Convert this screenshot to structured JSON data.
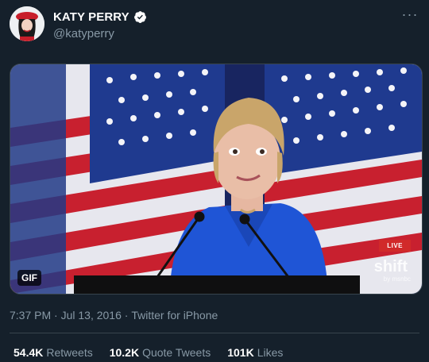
{
  "tweet": {
    "display_name": "KATY PERRY",
    "handle": "@katyperry",
    "more_label": "···"
  },
  "media": {
    "gif_label": "GIF",
    "live_label": "LIVE",
    "brand_label": "shift",
    "brand_sub_label": "by msnbc"
  },
  "meta": {
    "time": "7:37 PM",
    "sep1": " · ",
    "date": "Jul 13, 2016",
    "sep2": " · ",
    "source": "Twitter for iPhone"
  },
  "stats": {
    "retweets_count": "54.4K",
    "retweets_label": "Retweets",
    "quotes_count": "10.2K",
    "quotes_label": "Quote Tweets",
    "likes_count": "101K",
    "likes_label": "Likes"
  },
  "colors": {
    "background": "#15202b",
    "muted": "#8899a6",
    "verified": "#ffffff",
    "divider": "#38444d"
  }
}
